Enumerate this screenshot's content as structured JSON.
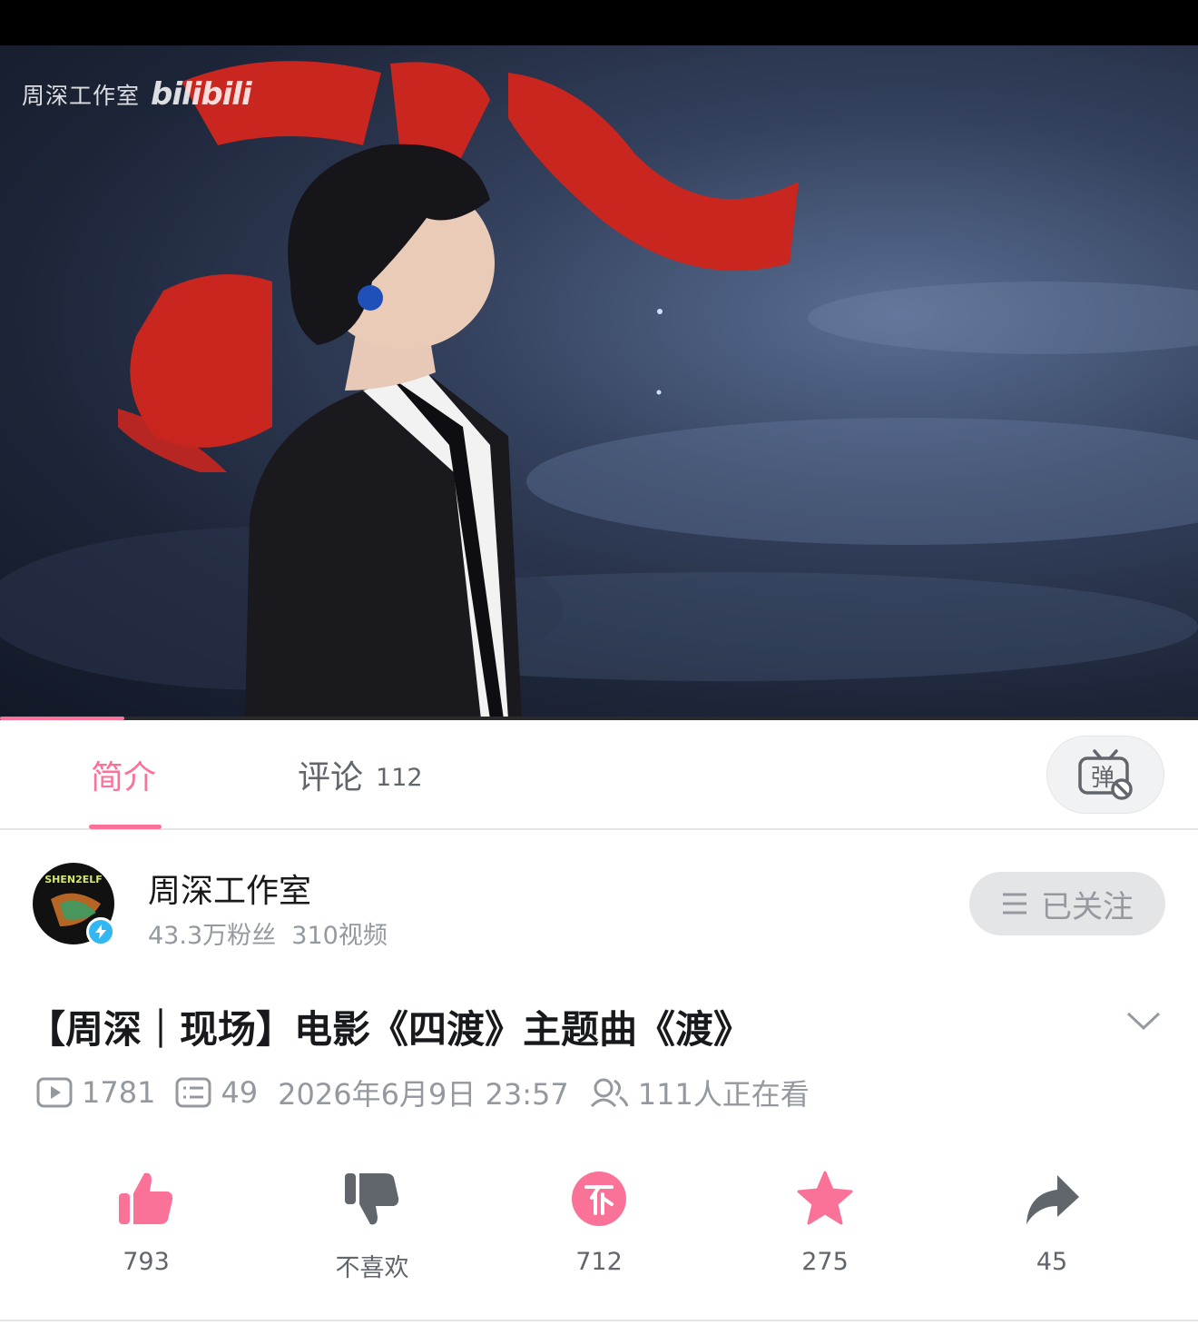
{
  "video": {
    "watermark_studio": "周深工作室",
    "watermark_logo": "bilibili",
    "progress": 0.104
  },
  "tabs": {
    "intro_label": "简介",
    "comments_label": "评论",
    "comments_count": "112",
    "danmaku_icon": "danmaku-off-icon"
  },
  "uploader": {
    "name": "周深工作室",
    "avatar_text": "SHEN2ELF",
    "fans": "43.3万粉丝",
    "videos": "310视频",
    "follow_label": "已关注"
  },
  "title": "【周深｜现场】电影《四渡》主题曲《渡》",
  "meta": {
    "plays": "1781",
    "danmaku": "49",
    "datetime": "2026年6月9日 23:57",
    "watching": "111人正在看"
  },
  "actions": {
    "like": "793",
    "dislike": "不喜欢",
    "coin": "712",
    "favorite": "275",
    "share": "45"
  },
  "colors": {
    "accent": "#fb7299",
    "muted": "#9499a0",
    "verified": "#33b7f2"
  }
}
